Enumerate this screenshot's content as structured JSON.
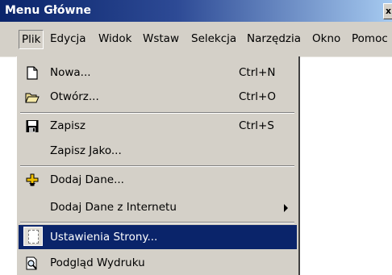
{
  "window": {
    "title": "Menu Główne",
    "close_label": "x"
  },
  "menubar": {
    "items": [
      {
        "label": "Plik"
      },
      {
        "label": "Edycja"
      },
      {
        "label": "Widok"
      },
      {
        "label": "Wstaw"
      },
      {
        "label": "Selekcja"
      },
      {
        "label": "Narzędzia"
      },
      {
        "label": "Okno"
      },
      {
        "label": "Pomoc"
      }
    ]
  },
  "menu": {
    "items": [
      {
        "label": "Nowa...",
        "shortcut": "Ctrl+N",
        "icon": "new-document-icon"
      },
      {
        "label": "Otwórz...",
        "shortcut": "Ctrl+O",
        "icon": "open-folder-icon"
      },
      {
        "label": "Zapisz",
        "shortcut": "Ctrl+S",
        "icon": "save-disk-icon"
      },
      {
        "label": "Zapisz Jako...",
        "shortcut": ""
      },
      {
        "label": "Dodaj Dane...",
        "shortcut": "",
        "icon": "add-data-icon"
      },
      {
        "label": "Dodaj Dane z Internetu",
        "shortcut": "",
        "submenu": true
      },
      {
        "label": "Ustawienia Strony...",
        "shortcut": "",
        "icon": "page-setup-icon",
        "highlighted": true
      },
      {
        "label": "Podgląd Wydruku",
        "shortcut": "",
        "icon": "print-preview-icon"
      }
    ]
  },
  "colors": {
    "titlebar_start": "#0a246a",
    "titlebar_end": "#a6caf0",
    "menu_bg": "#d4d0c8",
    "highlight": "#0a246a",
    "add_icon_yellow": "#f0c000"
  }
}
